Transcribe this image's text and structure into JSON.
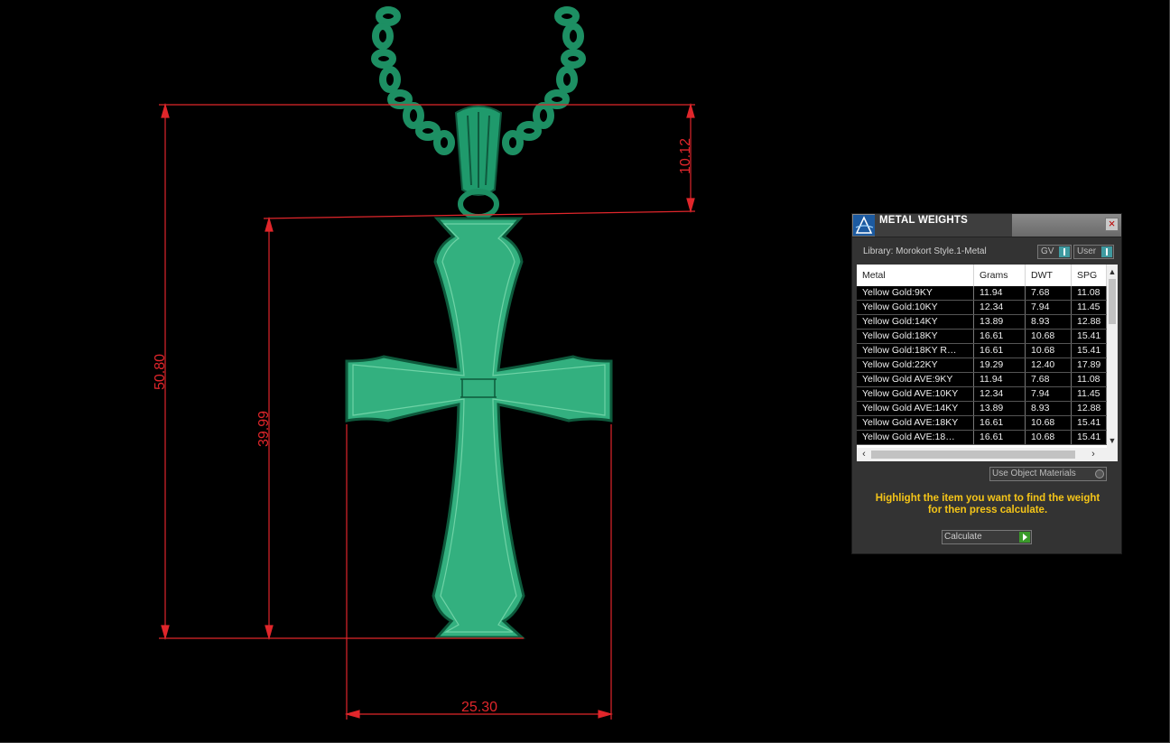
{
  "dimensions": {
    "total_height": "50.80",
    "cross_height": "39.99",
    "bail_height": "10.12",
    "cross_width": "25.30",
    "color": "#e0262b"
  },
  "model": {
    "color": "#2db07b"
  },
  "panel": {
    "title": "METAL WEIGHTS",
    "library_label": "Library: Morokort Style.1-Metal",
    "toggle_gv": "GV",
    "toggle_user": "User",
    "columns": [
      "Metal",
      "Grams",
      "DWT",
      "SPG"
    ],
    "rows": [
      [
        "Yellow Gold:9KY",
        "11.94",
        "7.68",
        "11.08"
      ],
      [
        "Yellow Gold:10KY",
        "12.34",
        "7.94",
        "11.45"
      ],
      [
        "Yellow Gold:14KY",
        "13.89",
        "8.93",
        "12.88"
      ],
      [
        "Yellow Gold:18KY",
        "16.61",
        "10.68",
        "15.41"
      ],
      [
        "Yellow Gold:18KY R…",
        "16.61",
        "10.68",
        "15.41"
      ],
      [
        "Yellow Gold:22KY",
        "19.29",
        "12.40",
        "17.89"
      ],
      [
        "Yellow Gold AVE:9KY",
        "11.94",
        "7.68",
        "11.08"
      ],
      [
        "Yellow Gold AVE:10KY",
        "12.34",
        "7.94",
        "11.45"
      ],
      [
        "Yellow Gold AVE:14KY",
        "13.89",
        "8.93",
        "12.88"
      ],
      [
        "Yellow Gold AVE:18KY",
        "16.61",
        "10.68",
        "15.41"
      ],
      [
        "Yellow Gold AVE:18…",
        "16.61",
        "10.68",
        "15.41"
      ]
    ],
    "use_object_materials": "Use Object Materials",
    "instruction_line1": "Highlight the item you want to find the weight",
    "instruction_line2": "for then press calculate.",
    "calculate_label": "Calculate",
    "accent_color": "#f5c518"
  }
}
